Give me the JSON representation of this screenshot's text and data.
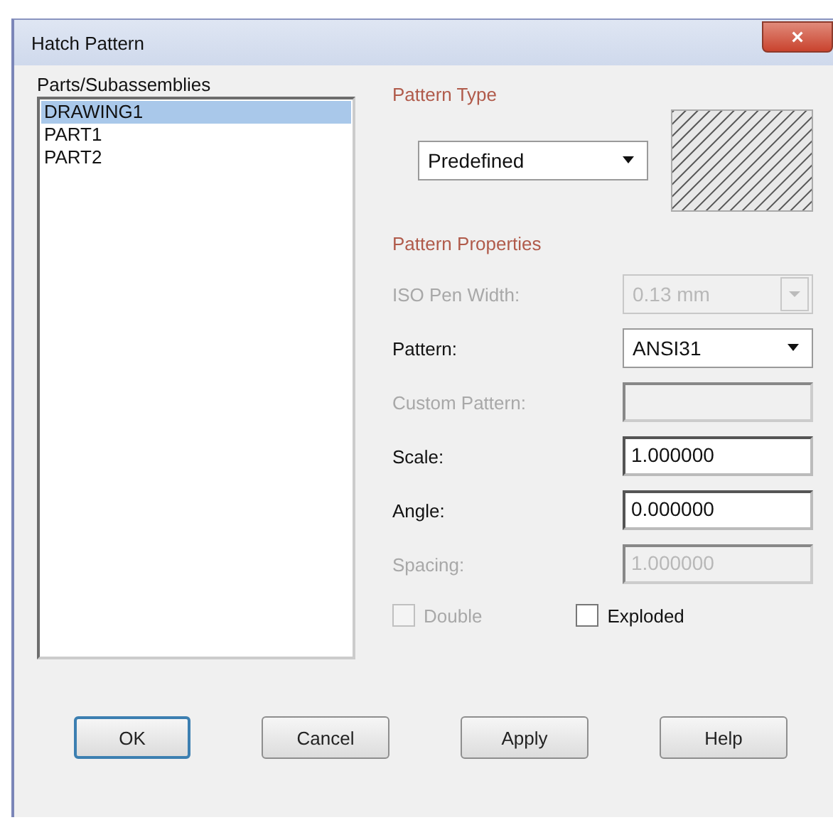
{
  "window": {
    "title": "Hatch Pattern",
    "close_label": "×"
  },
  "parts": {
    "label": "Parts/Subassemblies",
    "items": [
      {
        "label": "DRAWING1",
        "selected": true
      },
      {
        "label": "PART1",
        "selected": false
      },
      {
        "label": "PART2",
        "selected": false
      }
    ]
  },
  "pattern_type": {
    "title": "Pattern Type",
    "value": "Predefined"
  },
  "pattern_properties": {
    "title": "Pattern Properties",
    "rows": [
      {
        "kind": "dropdown",
        "label": "ISO Pen Width:",
        "value": "0.13 mm",
        "disabled": true
      },
      {
        "kind": "dropdown",
        "label": "Pattern:",
        "value": "ANSI31",
        "disabled": false
      },
      {
        "kind": "text",
        "label": "Custom Pattern:",
        "disabled": true
      },
      {
        "kind": "text",
        "label": "Scale:",
        "value": "1.000000",
        "disabled": false
      },
      {
        "kind": "text",
        "label": "Angle:",
        "value": "0.000000",
        "disabled": false
      },
      {
        "kind": "text",
        "label": "Spacing:",
        "value": "1.000000",
        "disabled": true
      }
    ],
    "checkboxes": [
      {
        "label": "Double",
        "checked": false,
        "disabled": true
      },
      {
        "label": "Exploded",
        "checked": false,
        "disabled": false
      }
    ]
  },
  "buttons": [
    {
      "label": "OK",
      "default": true
    },
    {
      "label": "Cancel",
      "default": false
    },
    {
      "label": "Apply",
      "default": false
    },
    {
      "label": "Help",
      "default": false
    }
  ]
}
